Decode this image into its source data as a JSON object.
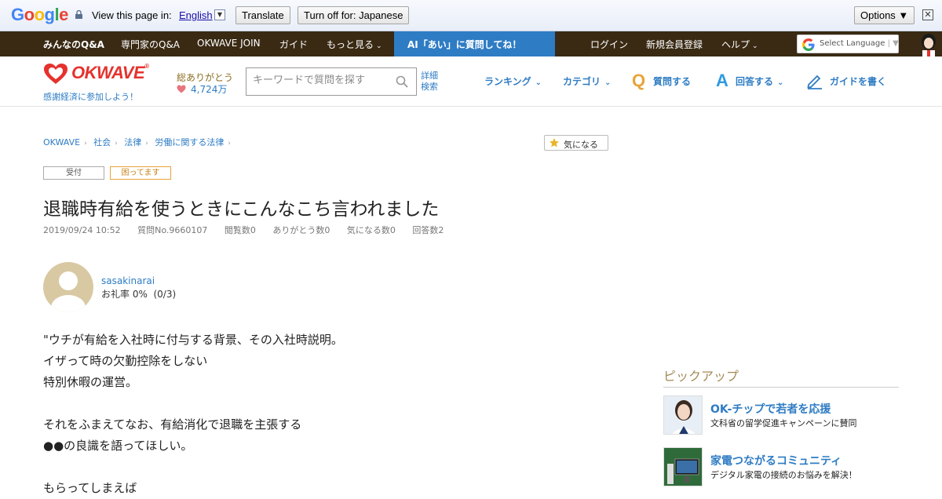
{
  "translate_bar": {
    "view_text": "View this page in:",
    "language": "English",
    "translate_label": "Translate",
    "turn_off_label": "Turn off for: Japanese",
    "options_label": "Options ▼"
  },
  "topnav": {
    "items": [
      "みんなのQ&A",
      "専門家のQ&A",
      "OKWAVE JOIN",
      "ガイド",
      "もっと見る"
    ],
    "ai_label": "AI「あい」に質問してね！",
    "right_items": [
      "ログイン",
      "新規会員登録",
      "ヘルプ"
    ],
    "select_language": "Select Language"
  },
  "header": {
    "logo_text": "OKWAVE",
    "tagline": "感謝経済に参加しよう！",
    "thanks_label": "総ありがとう",
    "thanks_count": "4,724万",
    "search_placeholder": "キーワードで質問を探す",
    "advanced_line1": "詳細",
    "advanced_line2": "検索",
    "nav": {
      "ranking": "ランキング",
      "category": "カテゴリ",
      "ask": "質問する",
      "answer": "回答する",
      "guide": "ガイドを書く"
    }
  },
  "breadcrumb": [
    "OKWAVE",
    "社会",
    "法律",
    "労働に関する法律"
  ],
  "favorite_label": "気になる",
  "tags": {
    "status": "受付",
    "trouble": "困ってます"
  },
  "question": {
    "title": "退職時有給を使うときにこんなこち言われました",
    "date": "2019/09/24 10:52",
    "number": "質問No.9660107",
    "views": "閲覧数0",
    "thanks": "ありがとう数0",
    "favorites": "気になる数0",
    "answers": "回答数2"
  },
  "user": {
    "name": "sasakinarai",
    "rate": "お礼率 0%  (0/3)"
  },
  "body_lines": [
    "\"ウチが有給を入社時に付与する背景、その入社時説明。",
    "イザって時の欠勤控除をしない",
    "特別休暇の運営。",
    "",
    "それをふまえてなお、有給消化で退職を主張する",
    "●●の良識を語ってほしい。",
    "",
    "もらってしまえば"
  ],
  "sidebar": {
    "pickup_title": "ピックアップ",
    "items": [
      {
        "title": "OK-チップで若者を応援",
        "desc": "文科省の留学促進キャンペーンに賛同"
      },
      {
        "title": "家電つながるコミュニティ",
        "desc": "デジタル家電の接続のお悩みを解決！"
      }
    ]
  },
  "colors": {
    "brand_red": "#e5322d",
    "link_blue": "#2e7cc4",
    "nav_brown": "#3a2a14",
    "pickup_gold": "#a38a57"
  }
}
